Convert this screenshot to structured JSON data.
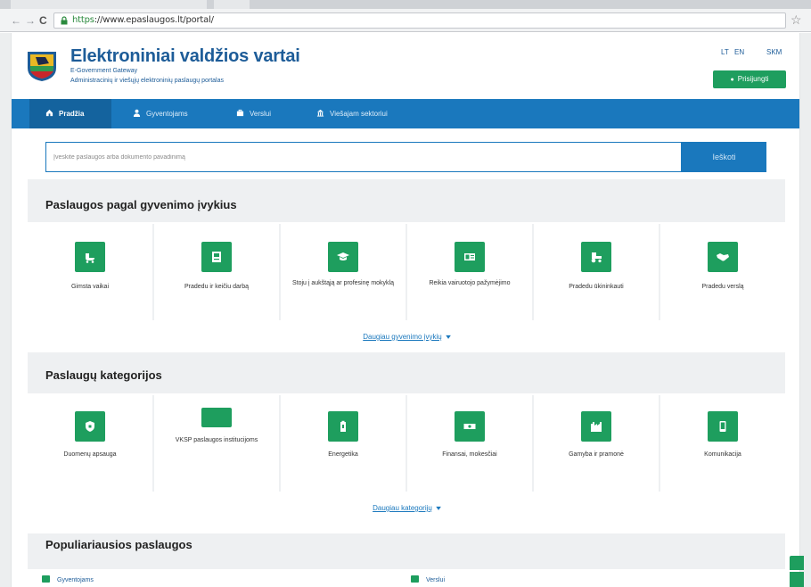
{
  "browser": {
    "url_scheme": "https",
    "url_rest": "://www.epaslaugos.lt/portal/"
  },
  "header": {
    "title": "Elektroniniai valdžios vartai",
    "subtitle": "E-Government Gateway",
    "description": "Administracinių ir viešųjų elektroninių paslaugų portalas",
    "lang_lt": "LT",
    "lang_en": "EN",
    "sitemap_label": "SKM",
    "login_label": "Prisijungti"
  },
  "nav": {
    "items": [
      {
        "label": "Pradžia",
        "icon": "home-icon"
      },
      {
        "label": "Gyventojams",
        "icon": "person-icon"
      },
      {
        "label": "Verslui",
        "icon": "briefcase-icon"
      },
      {
        "label": "Viešajam sektoriui",
        "icon": "building-icon"
      }
    ]
  },
  "search": {
    "placeholder": "Įveskite paslaugos arba dokumento pavadinimą",
    "button_label": "Ieškoti"
  },
  "life_events": {
    "title": "Paslaugos pagal gyvenimo įvykius",
    "cards": [
      {
        "label": "Gimsta vaikai",
        "icon": "baby-carriage-icon"
      },
      {
        "label": "Pradedu ir keičiu darbą",
        "icon": "id-badge-icon"
      },
      {
        "label": "Stoju į aukštąją ar profesinę mokyklą",
        "icon": "graduation-cap-icon"
      },
      {
        "label": "Reikia vairuotojo pažymėjimo",
        "icon": "driver-license-icon"
      },
      {
        "label": "Pradedu ūkininkauti",
        "icon": "tractor-icon"
      },
      {
        "label": "Pradedu verslą",
        "icon": "handshake-icon"
      }
    ],
    "more_label": "Daugiau gyvenimo įvykių"
  },
  "categories": {
    "title": "Paslaugų kategorijos",
    "cards": [
      {
        "label": "Duomenų apsauga",
        "icon": "shield-icon"
      },
      {
        "label": "VKSP paslaugos institucijoms",
        "icon": "blank-icon"
      },
      {
        "label": "Energetika",
        "icon": "battery-icon"
      },
      {
        "label": "Finansai, mokesčiai",
        "icon": "money-icon"
      },
      {
        "label": "Gamyba ir pramonė",
        "icon": "factory-icon"
      },
      {
        "label": "Komunikacija",
        "icon": "mobile-phone-icon"
      }
    ],
    "more_label": "Daugiau kategorijų"
  },
  "popular": {
    "title": "Populiariausios paslaugos",
    "col_citizens": "Gyventojams",
    "col_business": "Verslui"
  },
  "colors": {
    "brand_blue": "#1a78bd",
    "brand_green": "#1e9e5e",
    "title_blue": "#1d5c98"
  }
}
